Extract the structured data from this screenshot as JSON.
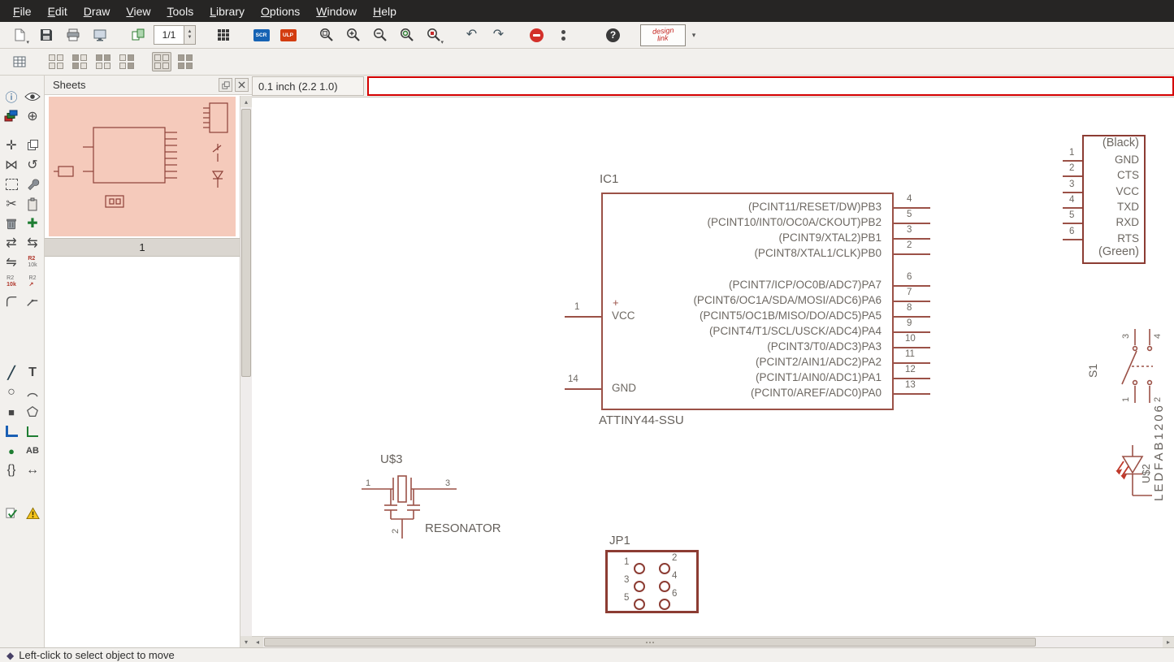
{
  "menu": {
    "items": [
      "File",
      "Edit",
      "Draw",
      "View",
      "Tools",
      "Library",
      "Options",
      "Window",
      "Help"
    ]
  },
  "toolbar": {
    "sheet_indicator": "1/1",
    "scr_label": "SCR",
    "ulp_label": "ULP",
    "design_link_top": "design",
    "design_link_bottom": "link"
  },
  "sheets": {
    "title": "Sheets",
    "page_label": "1"
  },
  "command_bar": {
    "grid_readout": "0.1 inch (2.2 1.0)",
    "command_value": ""
  },
  "status": {
    "bullet": "◆",
    "message": "Left-click to select object to move"
  },
  "icons": {
    "info": "ⓘ",
    "mark": "⊕",
    "move": "✛",
    "mirror": "⋈",
    "rotate": "↺",
    "cut": "✂",
    "add": "✚",
    "pinswap": "⇄",
    "gateswap": "⇆",
    "replace": "⇋",
    "wire": "╱",
    "text": "T",
    "circle": "○",
    "rect": "■",
    "junction": "●",
    "label": "AB",
    "attribute": "{}",
    "dimension": "↔",
    "undo": "↶",
    "redo": "↷",
    "help": "?",
    "name_ref": "R2",
    "value_ref": "10k",
    "smash_arrow": "↗",
    "dropdown": "▾",
    "spin_up": "▲",
    "spin_down": "▼",
    "scroll_left": "◂",
    "scroll_right": "▸",
    "scroll_up": "▴",
    "scroll_down": "▾"
  },
  "schematic": {
    "ic1": {
      "name": "IC1",
      "value": "ATTINY44-SSU",
      "vcc_plus": "+",
      "left_pins": [
        {
          "num": "1",
          "label": "VCC"
        },
        {
          "num": "14",
          "label": "GND"
        }
      ],
      "pins_top": [
        {
          "num": "4",
          "label": "(PCINT11/RESET/DW)PB3"
        },
        {
          "num": "5",
          "label": "(PCINT10/INT0/OC0A/CKOUT)PB2"
        },
        {
          "num": "3",
          "label": "(PCINT9/XTAL2)PB1"
        },
        {
          "num": "2",
          "label": "(PCINT8/XTAL1/CLK)PB0"
        }
      ],
      "pins_bottom": [
        {
          "num": "6",
          "label": "(PCINT7/ICP/OC0B/ADC7)PA7"
        },
        {
          "num": "7",
          "label": "(PCINT6/OC1A/SDA/MOSI/ADC6)PA6"
        },
        {
          "num": "8",
          "label": "(PCINT5/OC1B/MISO/DO/ADC5)PA5"
        },
        {
          "num": "9",
          "label": "(PCINT4/T1/SCL/USCK/ADC4)PA4"
        },
        {
          "num": "10",
          "label": "(PCINT3/T0/ADC3)PA3"
        },
        {
          "num": "11",
          "label": "(PCINT2/AIN1/ADC2)PA2"
        },
        {
          "num": "12",
          "label": "(PCINT1/AIN0/ADC1)PA1"
        },
        {
          "num": "13",
          "label": "(PCINT0/AREF/ADC0)PA0"
        }
      ]
    },
    "ftdi": {
      "labels": [
        "(Black)",
        "GND",
        "CTS",
        "VCC",
        "TXD",
        "RXD",
        "RTS",
        "(Green)"
      ],
      "pins": [
        "1",
        "2",
        "3",
        "4",
        "5",
        "6"
      ]
    },
    "s1": {
      "name": "S1",
      "pins": [
        "3",
        "4",
        "1",
        "2"
      ]
    },
    "led": {
      "name": "U$2",
      "value": "LEDFAB1206"
    },
    "resonator": {
      "name": "U$3",
      "value": "RESONATOR",
      "pins": [
        "1",
        "3",
        "2"
      ]
    },
    "jp1": {
      "name": "JP1",
      "pins": [
        "1",
        "2",
        "3",
        "4",
        "5",
        "6"
      ]
    }
  },
  "colors": {
    "symbol_line": "#9b5147",
    "symbol_outline": "#8c3c33",
    "pin_text": "#6d6862",
    "command_border": "#d40000"
  }
}
